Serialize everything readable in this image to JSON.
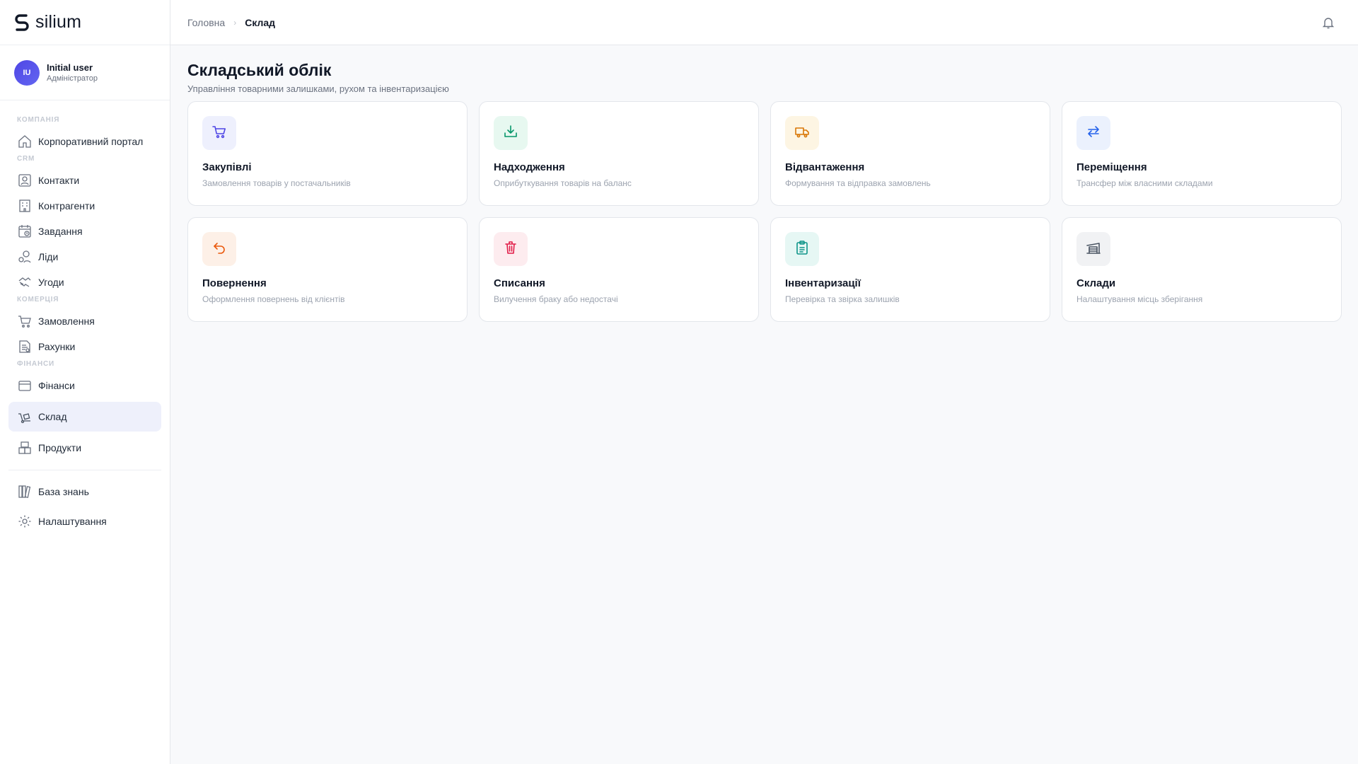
{
  "app": {
    "logo_text": "silium"
  },
  "user": {
    "initials": "IU",
    "name": "Initial user",
    "role": "Адміністратор"
  },
  "sidebar": {
    "sections": [
      {
        "label": "КОМПАНІЯ"
      },
      {
        "label": "CRM"
      },
      {
        "label": "КОМЕРЦІЯ"
      },
      {
        "label": "ФІНАНСИ"
      }
    ],
    "items": [
      {
        "label": "Корпоративний портал",
        "icon": "home-icon"
      },
      {
        "label": "Контакти",
        "icon": "contact-card-icon"
      },
      {
        "label": "Контрагенти",
        "icon": "building-icon"
      },
      {
        "label": "Завдання",
        "icon": "calendar-clock-icon"
      },
      {
        "label": "Ліди",
        "icon": "leads-icon"
      },
      {
        "label": "Угоди",
        "icon": "handshake-icon"
      },
      {
        "label": "Замовлення",
        "icon": "cart-icon"
      },
      {
        "label": "Рахунки",
        "icon": "invoice-icon"
      },
      {
        "label": "Фінанси",
        "icon": "wallet-icon"
      },
      {
        "label": "Склад",
        "icon": "dolly-icon",
        "active": true
      },
      {
        "label": "Продукти",
        "icon": "boxes-icon"
      },
      {
        "label": "База знань",
        "icon": "books-icon"
      },
      {
        "label": "Налаштування",
        "icon": "gear-icon"
      }
    ]
  },
  "header": {
    "breadcrumb_home": "Головна",
    "breadcrumb_separator": "›",
    "breadcrumb_current": "Склад"
  },
  "page": {
    "title": "Складський облік",
    "subtitle": "Управління товарними залишками, рухом та інвентаризацією"
  },
  "cards": [
    {
      "title": "Закупівлі",
      "desc": "Замовлення товарів у постачальників",
      "icon": "cart-icon",
      "color": "#4f46e5",
      "bg": "#eef0fd"
    },
    {
      "title": "Надходження",
      "desc": "Оприбуткування товарів на баланс",
      "icon": "download-tray-icon",
      "color": "#059669",
      "bg": "#e7f8f0"
    },
    {
      "title": "Відвантаження",
      "desc": "Формування та відправка замовлень",
      "icon": "truck-icon",
      "color": "#d97706",
      "bg": "#fdf5e3"
    },
    {
      "title": "Переміщення",
      "desc": "Трансфер між власними складами",
      "icon": "swap-arrows-icon",
      "color": "#2563eb",
      "bg": "#ebf1fd"
    },
    {
      "title": "Повернення",
      "desc": "Оформлення повернень від клієнтів",
      "icon": "return-arrow-icon",
      "color": "#ea580c",
      "bg": "#fdf0e7"
    },
    {
      "title": "Списання",
      "desc": "Вилучення браку або недостачі",
      "icon": "trash-icon",
      "color": "#e11d48",
      "bg": "#fdecef"
    },
    {
      "title": "Інвентаризації",
      "desc": "Перевірка та звірка залишків",
      "icon": "clipboard-icon",
      "color": "#0d9488",
      "bg": "#e6f7f4"
    },
    {
      "title": "Склади",
      "desc": "Налаштування місць зберігання",
      "icon": "warehouse-icon",
      "color": "#4b5563",
      "bg": "#f1f2f4"
    }
  ]
}
